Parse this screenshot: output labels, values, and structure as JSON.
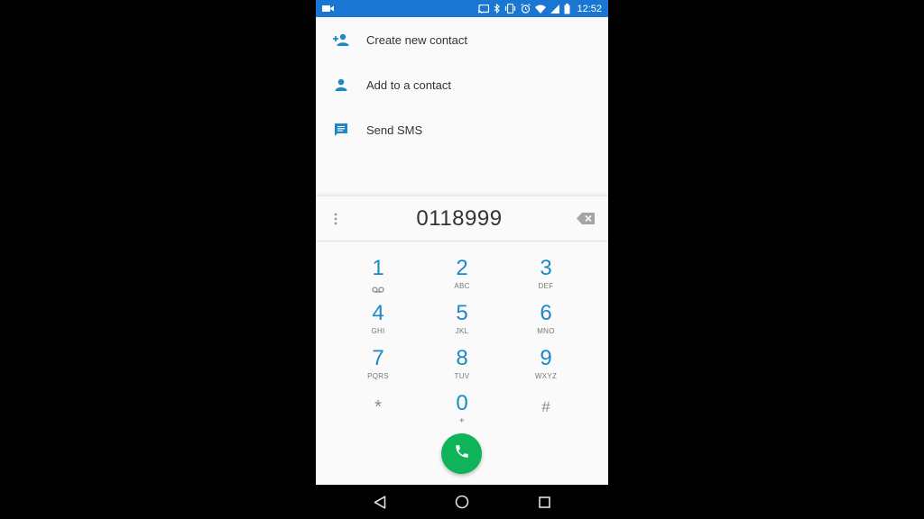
{
  "status_bar": {
    "time": "12:52",
    "icons": [
      "video-camera-icon",
      "cast-icon",
      "bluetooth-icon",
      "vibrate-icon",
      "alarm-icon",
      "wifi-icon",
      "cell-signal-icon",
      "battery-icon"
    ]
  },
  "actions": [
    {
      "label": "Create new contact",
      "icon": "person-add-icon"
    },
    {
      "label": "Add to a contact",
      "icon": "person-icon"
    },
    {
      "label": "Send SMS",
      "icon": "message-icon"
    }
  ],
  "dialer": {
    "digits": "0118999"
  },
  "keypad": [
    {
      "num": "1",
      "sub": "voicemail-icon"
    },
    {
      "num": "2",
      "sub": "ABC"
    },
    {
      "num": "3",
      "sub": "DEF"
    },
    {
      "num": "4",
      "sub": "GHI"
    },
    {
      "num": "5",
      "sub": "JKL"
    },
    {
      "num": "6",
      "sub": "MNO"
    },
    {
      "num": "7",
      "sub": "PQRS"
    },
    {
      "num": "8",
      "sub": "TUV"
    },
    {
      "num": "9",
      "sub": "WXYZ"
    },
    {
      "num": "*",
      "sub": ""
    },
    {
      "num": "0",
      "sub": "+"
    },
    {
      "num": "#",
      "sub": ""
    }
  ],
  "colors": {
    "status_bar": "#1976d2",
    "accent": "#1e88c7",
    "call_button": "#0fb35a"
  },
  "nav_bar": [
    "back-icon",
    "home-icon",
    "recents-icon"
  ]
}
